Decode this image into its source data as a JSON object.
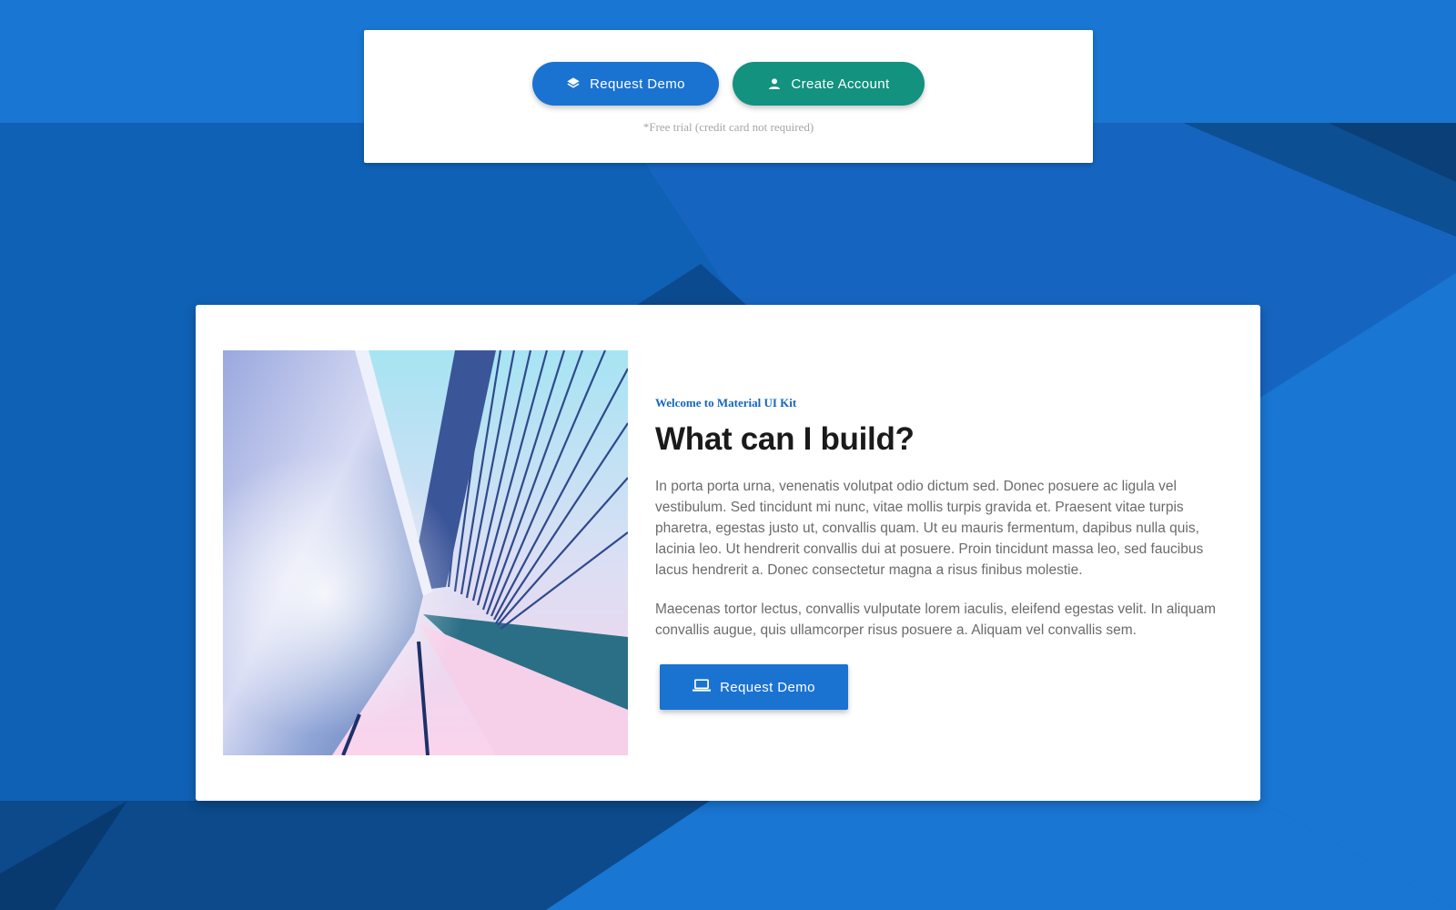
{
  "top_card": {
    "demo_button": {
      "label": "Request Demo",
      "icon": "layers-icon"
    },
    "account_button": {
      "label": "Create Account",
      "icon": "person-icon"
    },
    "note": "*Free trial (credit card not required)"
  },
  "feature": {
    "image": {
      "description_icon": "bridge-photo"
    },
    "eyebrow": "Welcome to Material UI Kit",
    "title": "What can I build?",
    "paragraphs": [
      "In porta porta urna, venenatis volutpat odio dictum sed. Donec posuere ac ligula vel vestibulum. Sed tincidunt mi nunc, vitae mollis turpis gravida et. Praesent vitae turpis pharetra, egestas justo ut, convallis quam. Ut eu mauris fermentum, dapibus nulla quis, lacinia leo. Ut hendrerit convallis dui at posuere. Proin tincidunt massa leo, sed faucibus lacus hendrerit a. Donec consectetur magna a risus finibus molestie.",
      "Maecenas tortor lectus, convallis vulputate lorem iaculis, eleifend egestas velit. In aliquam convallis augue, quis ullamcorper risus posuere a. Aliquam vel convallis sem."
    ],
    "cta_button": {
      "label": "Request Demo",
      "icon": "laptop-icon"
    }
  },
  "colors": {
    "primary": "#1a73d1",
    "secondary": "#12927f",
    "background": "#1976d2",
    "accent_text": "#1565c0"
  }
}
